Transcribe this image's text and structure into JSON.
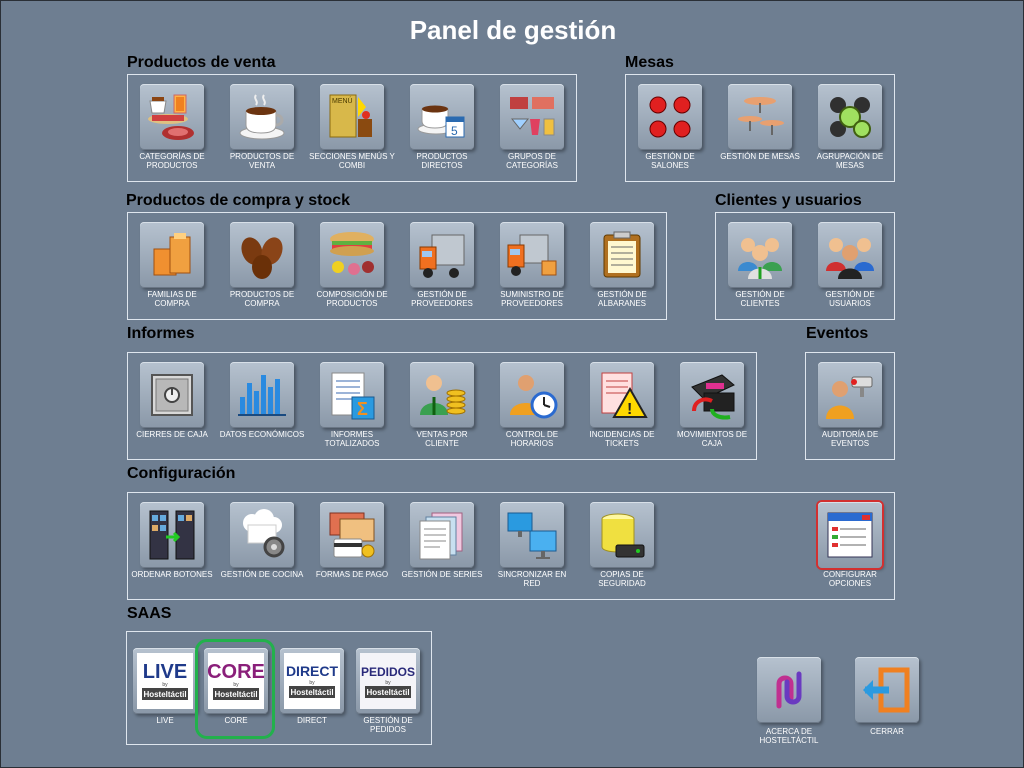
{
  "page": {
    "title": "Panel de gestión"
  },
  "sections": {
    "productos_venta": "Productos de venta",
    "mesas": "Mesas",
    "compra_stock": "Productos de compra y stock",
    "clientes": "Clientes y usuarios",
    "informes": "Informes",
    "eventos": "Eventos",
    "configuracion": "Configuración",
    "saas": "SAAS"
  },
  "tiles": {
    "categorias_productos": "CATEGORÍAS DE PRODUCTOS",
    "productos_venta": "PRODUCTOS DE VENTA",
    "secciones_menus": "SECCIONES MENÚS Y COMBI",
    "productos_directos": "PRODUCTOS DIRECTOS",
    "grupos_categorias": "GRUPOS DE CATEGORÍAS",
    "gestion_salones": "GESTIÓN DE SALONES",
    "gestion_mesas": "GESTIÓN DE MESAS",
    "agrupacion_mesas": "AGRUPACIÓN DE MESAS",
    "familias_compra": "FAMILIAS DE COMPRA",
    "productos_compra": "PRODUCTOS DE COMPRA",
    "composicion_productos": "COMPOSICIÓN DE PRODUCTOS",
    "gestion_proveedores": "GESTIÓN DE PROVEEDORES",
    "suministro_proveedores": "SUMINISTRO DE PROVEEDORES",
    "gestion_albaranes": "GESTIÓN DE ALBARANES",
    "gestion_clientes": "GESTIÓN DE CLIENTES",
    "gestion_usuarios": "GESTIÓN DE USUARIOS",
    "cierres_caja": "CIERRES DE CAJA",
    "datos_economicos": "DATOS ECONÓMICOS",
    "informes_totalizados": "INFORMES TOTALIZADOS",
    "ventas_cliente": "VENTAS POR CLIENTE",
    "control_horarios": "CONTROL DE HORARIOS",
    "incidencias_tickets": "INCIDENCIAS DE TICKETS",
    "movimientos_caja": "MOVIMIENTOS DE CAJA",
    "auditoria_eventos": "AUDITORÍA DE EVENTOS",
    "ordenar_botones": "ORDENAR BOTONES",
    "gestion_cocina": "GESTIÓN DE COCINA",
    "formas_pago": "FORMAS DE PAGO",
    "gestion_series": "GESTIÓN DE SERIES",
    "sincronizar_red": "SINCRONIZAR EN RED",
    "copias_seguridad": "COPIAS DE SEGURIDAD",
    "configurar_opciones": "CONFIGURAR OPCIONES",
    "live": "LIVE",
    "core": "CORE",
    "direct": "DIRECT",
    "gestion_pedidos": "GESTIÓN DE PEDIDOS",
    "acerca": "ACERCA DE HOSTELTÁCTIL",
    "cerrar": "CERRAR"
  },
  "logos": {
    "live": {
      "word": "LIVE",
      "by": "by",
      "brand": "Hosteltáctil",
      "color": "#1f3a8a"
    },
    "core": {
      "word": "CORE",
      "by": "by",
      "brand": "Hosteltáctil",
      "color": "#8a1f7a"
    },
    "direct": {
      "word": "DIRECT",
      "by": "by",
      "brand": "Hosteltáctil",
      "color": "#1f3a8a"
    },
    "pedidos": {
      "word": "PEDIDOS",
      "by": "by",
      "brand": "Hosteltáctil",
      "color": "#2a2a7a"
    }
  },
  "colors": {
    "background": "#6e7e91",
    "selected_border": "#d23030",
    "highlight": "#22b14c"
  }
}
